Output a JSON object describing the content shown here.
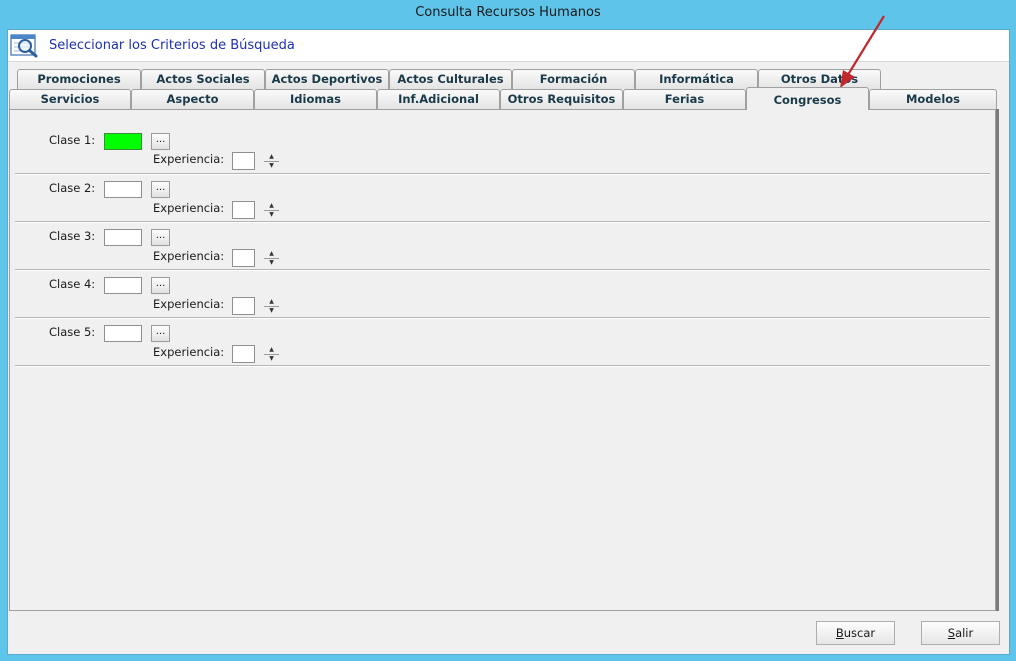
{
  "window": {
    "title": "Consulta Recursos Humanos"
  },
  "header": {
    "title": "Seleccionar los Criterios de Búsqueda",
    "icon": "search-document-icon"
  },
  "tabs_row_back": [
    {
      "label": "Promociones"
    },
    {
      "label": "Actos Sociales"
    },
    {
      "label": "Actos Deportivos"
    },
    {
      "label": "Actos Culturales"
    },
    {
      "label": "Formación"
    },
    {
      "label": "Informática"
    },
    {
      "label": "Otros Datos"
    }
  ],
  "tabs_row_front": [
    {
      "label": "Servicios"
    },
    {
      "label": "Aspecto"
    },
    {
      "label": "Idiomas"
    },
    {
      "label": "Inf.Adicional"
    },
    {
      "label": "Otros Requisitos"
    },
    {
      "label": "Ferias"
    },
    {
      "label": "Congresos",
      "active": true
    },
    {
      "label": "Modelos"
    }
  ],
  "congresos": {
    "rows": [
      {
        "label": "Clase 1:",
        "value": "",
        "highlighted": true,
        "lookup": "...",
        "experience_label": "Experiencia:",
        "experience_value": ""
      },
      {
        "label": "Clase 2:",
        "value": "",
        "lookup": "...",
        "experience_label": "Experiencia:",
        "experience_value": ""
      },
      {
        "label": "Clase 3:",
        "value": "",
        "lookup": "...",
        "experience_label": "Experiencia:",
        "experience_value": ""
      },
      {
        "label": "Clase 4:",
        "value": "",
        "lookup": "...",
        "experience_label": "Experiencia:",
        "experience_value": ""
      },
      {
        "label": "Clase 5:",
        "value": "",
        "lookup": "...",
        "experience_label": "Experiencia:",
        "experience_value": ""
      }
    ]
  },
  "buttons": {
    "buscar": {
      "label": "Buscar",
      "accesskey": "B"
    },
    "salir": {
      "label": "Salir",
      "accesskey": "S"
    }
  },
  "colors": {
    "highlight_field": "#00ff00",
    "annotation_arrow": "#c0282d",
    "title_bar": "#5fc4ea",
    "header_text": "#1f2fb3"
  }
}
